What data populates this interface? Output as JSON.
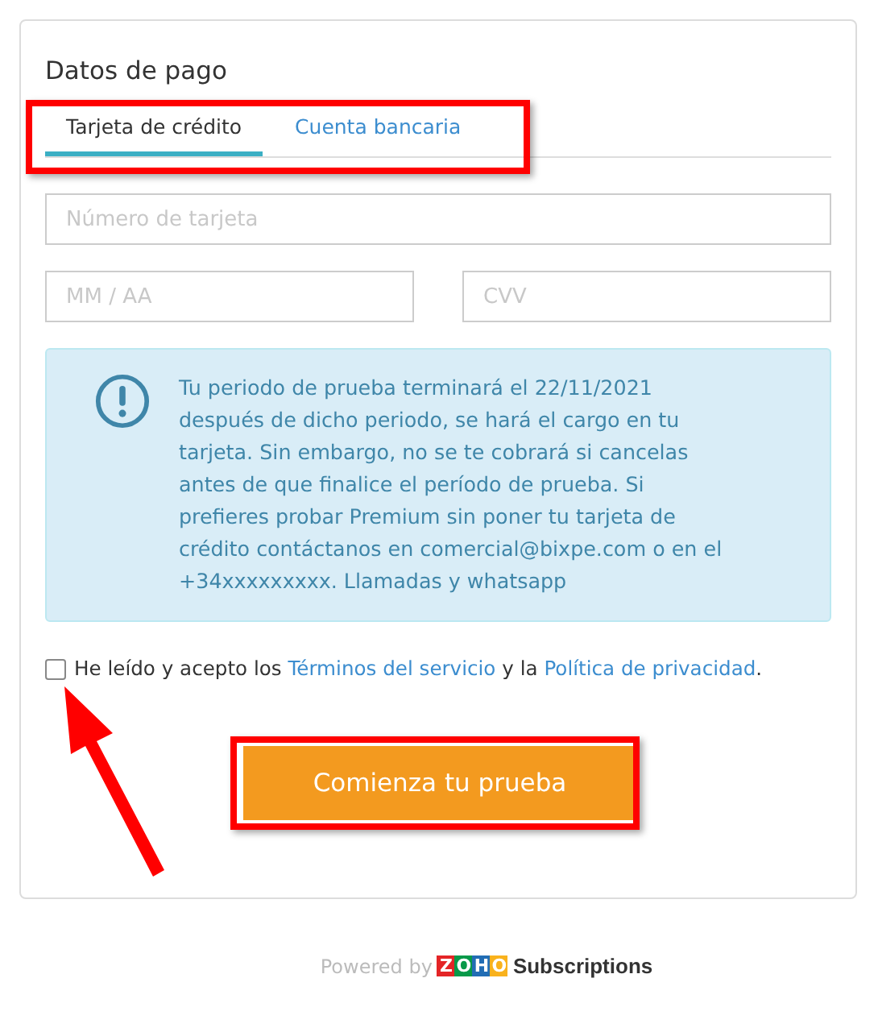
{
  "form": {
    "title": "Datos de pago",
    "tabs": [
      {
        "label": "Tarjeta de crédito",
        "selected": true
      },
      {
        "label": "Cuenta bancaria",
        "selected": false
      }
    ],
    "fields": [
      {
        "placeholder": "Número de tarjeta"
      },
      {
        "placeholder": "MM / AA"
      },
      {
        "placeholder": "CVV"
      }
    ],
    "notice": {
      "lines": [
        "Tu periodo de prueba terminará el 22/11/2021",
        "después de dicho periodo, se hará el cargo en tu",
        "tarjeta. Sin embargo, no se te cobrará si cancelas",
        "antes de que finalice el período de prueba. Si",
        "prefieres probar Premium sin poner tu tarjeta de",
        "crédito contáctanos en comercial@bixpe.com o en el",
        "+34xxxxxxxxx. Llamadas y whatsapp"
      ]
    },
    "consent": {
      "checked": false,
      "parts": [
        {
          "kind": "text",
          "text": "He leído y acepto los "
        },
        {
          "kind": "link",
          "text": "Términos del servicio"
        },
        {
          "kind": "text",
          "text": " y la "
        },
        {
          "kind": "link",
          "text": "Política de privacidad"
        },
        {
          "kind": "text",
          "text": "."
        }
      ]
    },
    "submit": {
      "label": "Comienza tu prueba"
    }
  },
  "footer": {
    "powered_by": "Powered by",
    "logo_letters": [
      {
        "text": "Z",
        "color": "#e42527"
      },
      {
        "text": "O",
        "color": "#089949"
      },
      {
        "text": "H",
        "color": "#226db4"
      },
      {
        "text": "O",
        "color": "#f9b21d"
      }
    ],
    "product": "Subscriptions"
  },
  "annotations": {
    "tabs_framed": true,
    "submit_framed": true,
    "checkbox_arrow": true
  }
}
